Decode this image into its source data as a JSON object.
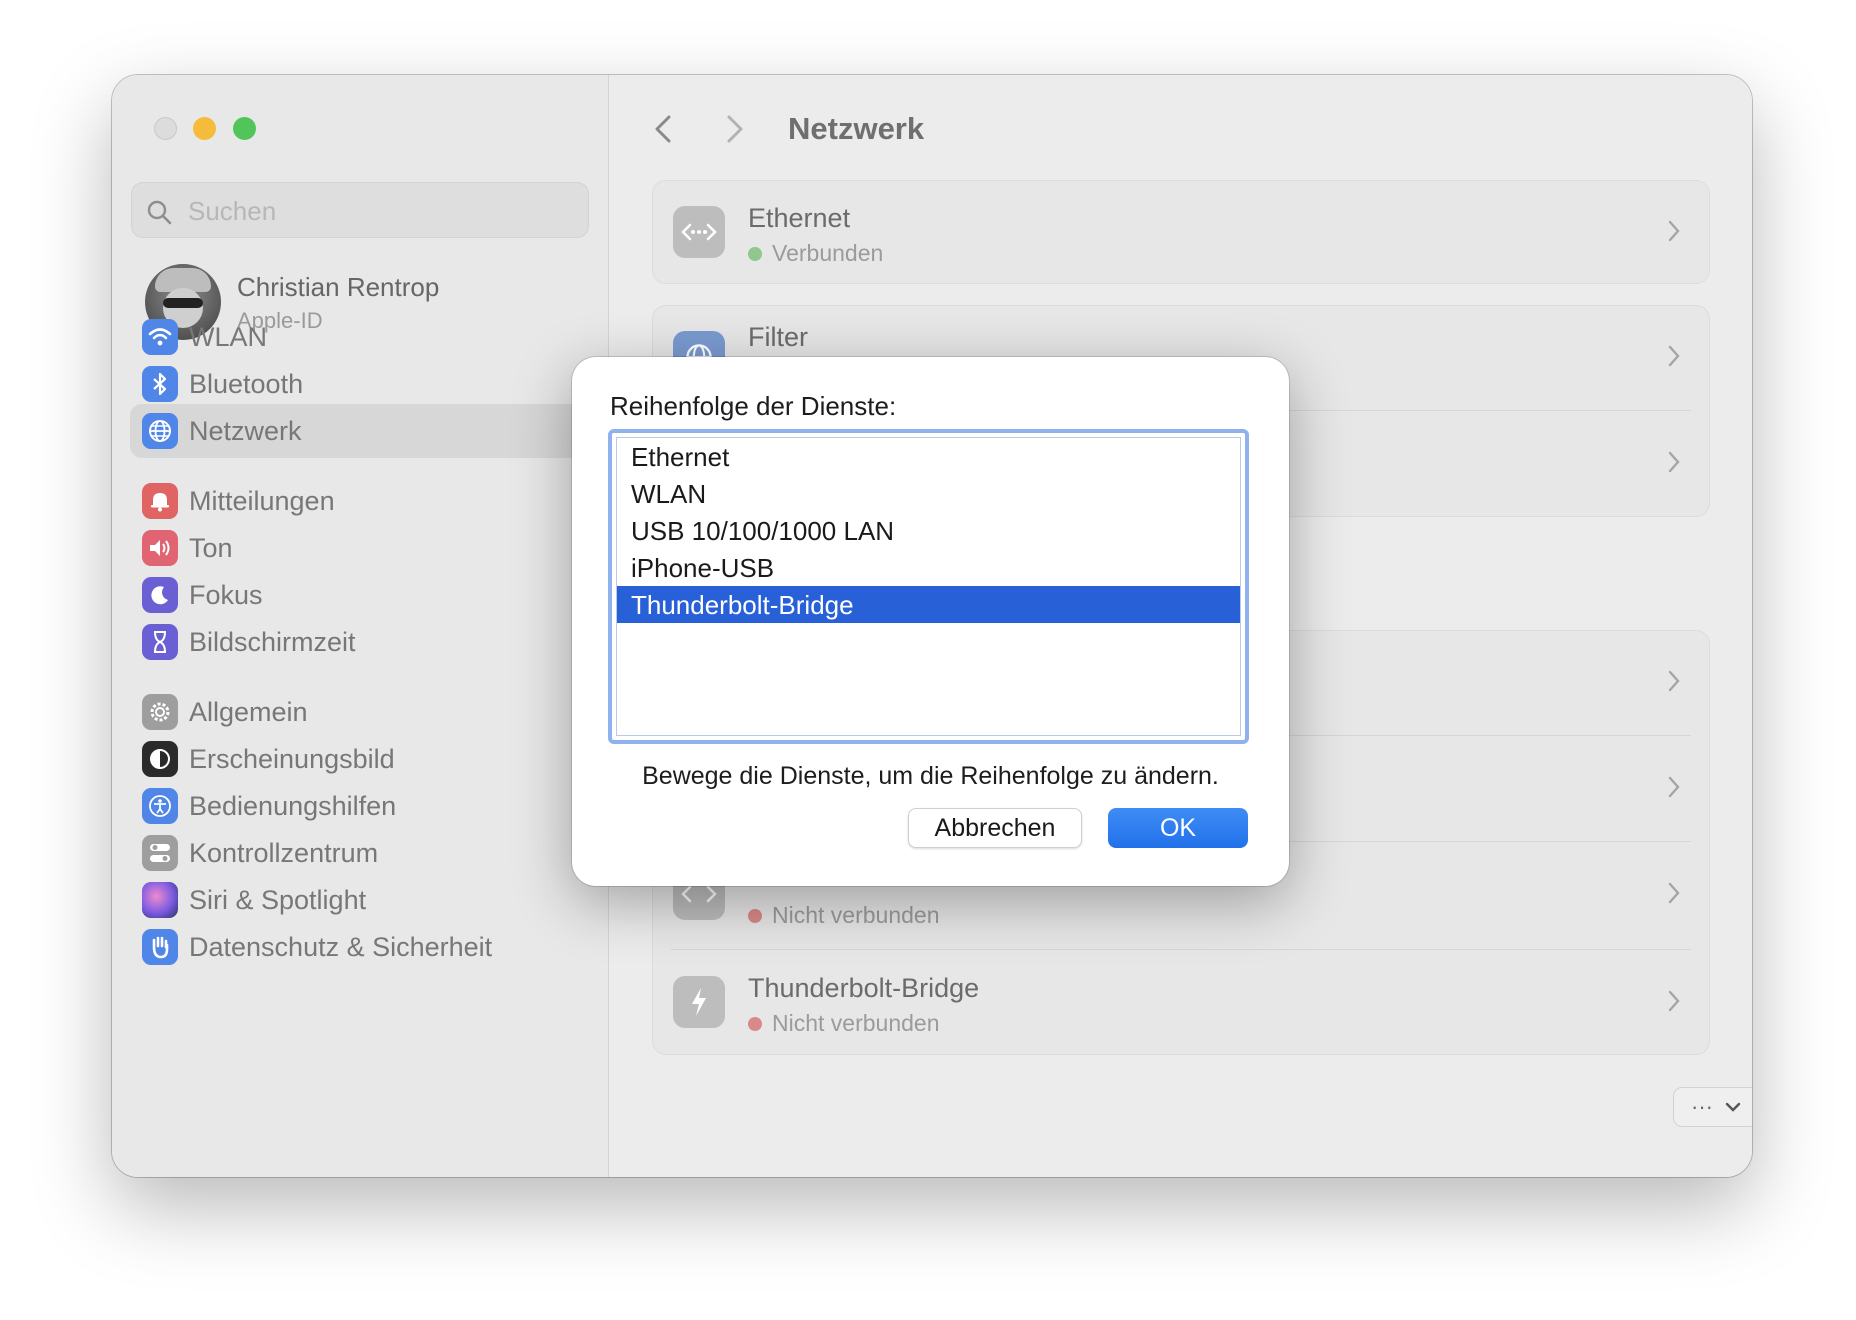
{
  "window": {
    "title": "Netzwerk"
  },
  "sidebar": {
    "search_placeholder": "Suchen",
    "user": {
      "name": "Christian Rentrop",
      "subtitle": "Apple-ID"
    },
    "items": [
      {
        "label": "WLAN",
        "icon": "wifi-icon",
        "color": "#4f86e8"
      },
      {
        "label": "Bluetooth",
        "icon": "bluetooth-icon",
        "color": "#4f86e8"
      },
      {
        "label": "Netzwerk",
        "icon": "globe-icon",
        "color": "#4f86e8",
        "active": true
      },
      {
        "label": "Mitteilungen",
        "icon": "bell-icon",
        "color": "#e06464"
      },
      {
        "label": "Ton",
        "icon": "speaker-icon",
        "color": "#e06472"
      },
      {
        "label": "Fokus",
        "icon": "moon-icon",
        "color": "#6a60d4"
      },
      {
        "label": "Bildschirmzeit",
        "icon": "hourglass-icon",
        "color": "#6a60d4"
      },
      {
        "label": "Allgemein",
        "icon": "gear-icon",
        "color": "#9e9e9e"
      },
      {
        "label": "Erscheinungsbild",
        "icon": "appearance-icon",
        "color": "#2a2a2a"
      },
      {
        "label": "Bedienungshilfen",
        "icon": "accessibility-icon",
        "color": "#4f86e8"
      },
      {
        "label": "Kontrollzentrum",
        "icon": "toggles-icon",
        "color": "#9e9e9e"
      },
      {
        "label": "Siri & Spotlight",
        "icon": "siri-icon",
        "color": "#b15cd6"
      },
      {
        "label": "Datenschutz & Sicherheit",
        "icon": "hand-icon",
        "color": "#4f86e8"
      }
    ]
  },
  "main": {
    "title": "Netzwerk",
    "services": [
      {
        "name": "Ethernet",
        "status": "Verbunden",
        "state": "connected"
      },
      {
        "name": "Filter",
        "status": "",
        "state": "none"
      },
      {
        "name": "",
        "status": "Nicht verbunden",
        "state": "disconnected"
      },
      {
        "name": "Thunderbolt-Bridge",
        "status": "Nicht verbunden",
        "state": "disconnected"
      }
    ],
    "more_label": "···",
    "help_label": "?"
  },
  "dialog": {
    "title": "Reihenfolge der Dienste:",
    "items": [
      "Ethernet",
      "WLAN",
      "USB 10/100/1000 LAN",
      "iPhone-USB",
      "Thunderbolt-Bridge"
    ],
    "selected_index": 4,
    "hint": "Bewege die Dienste, um die Reihenfolge zu ändern.",
    "cancel_label": "Abbrechen",
    "ok_label": "OK"
  },
  "colors": {
    "accent": "#2860d8",
    "ok_button": "#2a78ee",
    "connected": "#8fc78f",
    "disconnected": "#d98a88"
  }
}
